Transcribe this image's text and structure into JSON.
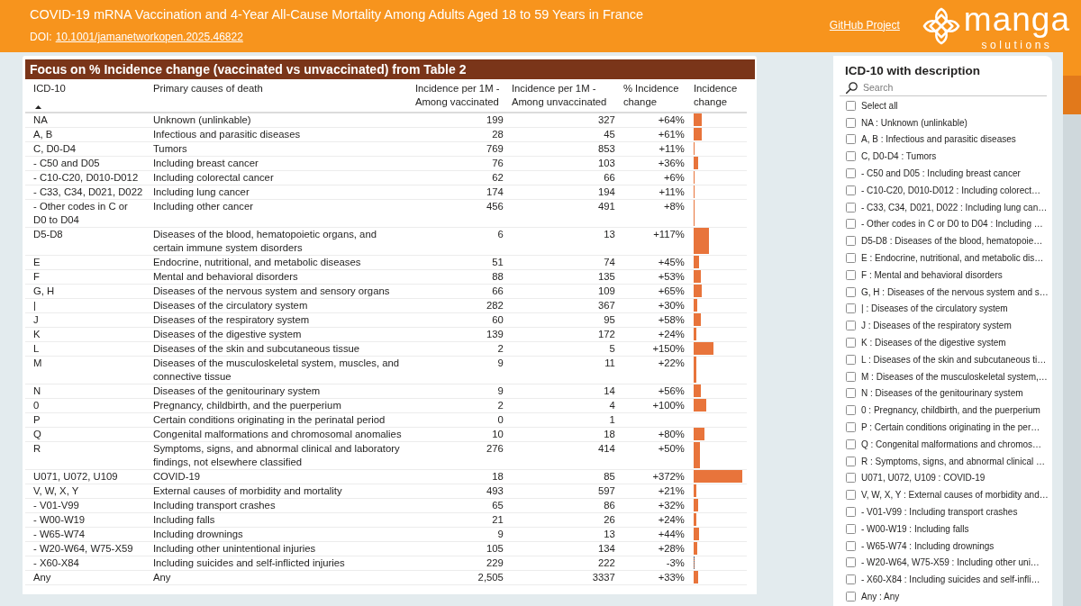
{
  "header": {
    "title": "COVID-19 mRNA Vaccination and 4-Year All-Cause Mortality Among Adults Aged 18 to 59 Years in France",
    "doi_label": "DOI:",
    "doi_link": "10.1001/jamanetworkopen.2025.46822",
    "github_link": "GitHub Project",
    "logo": {
      "name": "manga",
      "tagline": "solutions"
    }
  },
  "table": {
    "title": "Focus on % Incidence change (vaccinated vs unvaccinated) from Table 2",
    "columns": [
      {
        "label": "ICD-10",
        "sorted": true
      },
      {
        "label": "Primary causes of death",
        "sorted": false
      },
      {
        "label": "Incidence per 1M - Among vaccinated",
        "sorted": false
      },
      {
        "label": "Incidence per 1M - Among unvaccinated",
        "sorted": false
      },
      {
        "label": "% Incidence change",
        "sorted": false
      },
      {
        "label": "Incidence change",
        "sorted": false
      }
    ],
    "rows": [
      {
        "icd": "NA",
        "cause": "Unknown (unlinkable)",
        "vaccinated": "199",
        "unvaccinated": "327",
        "change": "+64%"
      },
      {
        "icd": "A, B",
        "cause": "Infectious and parasitic diseases",
        "vaccinated": "28",
        "unvaccinated": "45",
        "change": "+61%"
      },
      {
        "icd": "C, D0-D4",
        "cause": "Tumors",
        "vaccinated": "769",
        "unvaccinated": "853",
        "change": "+11%"
      },
      {
        "icd": "- C50 and D05",
        "cause": "Including breast cancer",
        "vaccinated": "76",
        "unvaccinated": "103",
        "change": "+36%"
      },
      {
        "icd": "- C10-C20, D010-D012",
        "cause": "Including colorectal cancer",
        "vaccinated": "62",
        "unvaccinated": "66",
        "change": "+6%"
      },
      {
        "icd": "- C33, C34, D021, D022",
        "cause": "Including lung cancer",
        "vaccinated": "174",
        "unvaccinated": "194",
        "change": "+11%"
      },
      {
        "icd": "- Other codes in C or D0 to D04",
        "cause": "Including other cancer",
        "vaccinated": "456",
        "unvaccinated": "491",
        "change": "+8%"
      },
      {
        "icd": "D5-D8",
        "cause": "Diseases of the blood, hematopoietic organs, and certain immune system disorders",
        "vaccinated": "6",
        "unvaccinated": "13",
        "change": "+117%"
      },
      {
        "icd": "E",
        "cause": "Endocrine, nutritional, and metabolic diseases",
        "vaccinated": "51",
        "unvaccinated": "74",
        "change": "+45%"
      },
      {
        "icd": "F",
        "cause": "Mental and behavioral disorders",
        "vaccinated": "88",
        "unvaccinated": "135",
        "change": "+53%"
      },
      {
        "icd": "G, H",
        "cause": "Diseases of the nervous system and sensory organs",
        "vaccinated": "66",
        "unvaccinated": "109",
        "change": "+65%"
      },
      {
        "icd": "|",
        "cause": "Diseases of the circulatory system",
        "vaccinated": "282",
        "unvaccinated": "367",
        "change": "+30%"
      },
      {
        "icd": "J",
        "cause": "Diseases of the respiratory system",
        "vaccinated": "60",
        "unvaccinated": "95",
        "change": "+58%"
      },
      {
        "icd": "K",
        "cause": "Diseases of the digestive system",
        "vaccinated": "139",
        "unvaccinated": "172",
        "change": "+24%"
      },
      {
        "icd": "L",
        "cause": "Diseases of the skin and subcutaneous tissue",
        "vaccinated": "2",
        "unvaccinated": "5",
        "change": "+150%"
      },
      {
        "icd": "M",
        "cause": "Diseases of the musculoskeletal system, muscles, and connective tissue",
        "vaccinated": "9",
        "unvaccinated": "11",
        "change": "+22%"
      },
      {
        "icd": "N",
        "cause": "Diseases of the genitourinary system",
        "vaccinated": "9",
        "unvaccinated": "14",
        "change": "+56%"
      },
      {
        "icd": "0",
        "cause": "Pregnancy, childbirth, and the puerperium",
        "vaccinated": "2",
        "unvaccinated": "4",
        "change": "+100%"
      },
      {
        "icd": "P",
        "cause": "Certain conditions originating in the perinatal period",
        "vaccinated": "0",
        "unvaccinated": "1"
      },
      {
        "icd": "Q",
        "cause": "Congenital malformations and chromosomal anomalies",
        "vaccinated": "10",
        "unvaccinated": "18",
        "change": "+80%"
      },
      {
        "icd": "R",
        "cause": "Symptoms, signs, and abnormal clinical and laboratory findings, not elsewhere classified",
        "vaccinated": "276",
        "unvaccinated": "414",
        "change": "+50%"
      },
      {
        "icd": "U071, U072, U109",
        "cause": "COVID-19",
        "vaccinated": "18",
        "unvaccinated": "85",
        "change": "+372%"
      },
      {
        "icd": "V, W, X, Y",
        "cause": "External causes of morbidity and mortality",
        "vaccinated": "493",
        "unvaccinated": "597",
        "change": "+21%"
      },
      {
        "icd": "- V01-V99",
        "cause": "Including transport crashes",
        "vaccinated": "65",
        "unvaccinated": "86",
        "change": "+32%"
      },
      {
        "icd": "- W00-W19",
        "cause": "Including falls",
        "vaccinated": "21",
        "unvaccinated": "26",
        "change": "+24%"
      },
      {
        "icd": "- W65-W74",
        "cause": "Including drownings",
        "vaccinated": "9",
        "unvaccinated": "13",
        "change": "+44%"
      },
      {
        "icd": "- W20-W64, W75-X59",
        "cause": "Including other unintentional injuries",
        "vaccinated": "105",
        "unvaccinated": "134",
        "change": "+28%"
      },
      {
        "icd": "- X60-X84",
        "cause": "Including suicides and self-inflicted injuries",
        "vaccinated": "229",
        "unvaccinated": "222",
        "change": "-3%"
      },
      {
        "icd": "Any",
        "cause": "Any",
        "vaccinated": "2,505",
        "unvaccinated": "3337",
        "change": "+33%"
      }
    ]
  },
  "slicer": {
    "title": "ICD-10 with description",
    "search": {
      "placeholder": "Search"
    },
    "items": [
      {
        "label": "Select all",
        "checked": false
      },
      {
        "label": "NA : Unknown (unlinkable)",
        "checked": false
      },
      {
        "label": "A, B : Infectious and parasitic diseases",
        "checked": false
      },
      {
        "label": "C, D0-D4 : Tumors",
        "checked": false
      },
      {
        "label": "- C50 and D05 : Including breast cancer",
        "checked": false
      },
      {
        "label": "- C10-C20, D010-D012 : Including colorect…",
        "checked": false
      },
      {
        "label": "- C33, C34, D021, D022 : Including lung can…",
        "checked": false
      },
      {
        "label": "- Other codes in C or D0 to D04 : Including …",
        "checked": false
      },
      {
        "label": "D5-D8 : Diseases of the blood, hematopoie…",
        "checked": false
      },
      {
        "label": "E : Endocrine, nutritional, and metabolic dis…",
        "checked": false
      },
      {
        "label": "F : Mental and behavioral disorders",
        "checked": false
      },
      {
        "label": "G, H : Diseases of the nervous system and s…",
        "checked": false
      },
      {
        "label": "| : Diseases of the circulatory system",
        "checked": false
      },
      {
        "label": "J : Diseases of the respiratory system",
        "checked": false
      },
      {
        "label": "K : Diseases of the digestive system",
        "checked": false
      },
      {
        "label": "L : Diseases of the skin and subcutaneous ti…",
        "checked": false
      },
      {
        "label": "M : Diseases of the musculoskeletal system,…",
        "checked": false
      },
      {
        "label": "N : Diseases of the genitourinary system",
        "checked": false
      },
      {
        "label": "0 : Pregnancy, childbirth, and the puerperium",
        "checked": false
      },
      {
        "label": "P : Certain conditions originating in the per…",
        "checked": false
      },
      {
        "label": "Q : Congenital malformations and chromos…",
        "checked": false
      },
      {
        "label": "R : Symptoms, signs, and abnormal clinical …",
        "checked": false
      },
      {
        "label": "U071, U072, U109 : COVID-19",
        "checked": false
      },
      {
        "label": "V, W, X, Y : External causes of morbidity and…",
        "checked": false
      },
      {
        "label": "- V01-V99 : Including transport crashes",
        "checked": false
      },
      {
        "label": "- W00-W19 : Including falls",
        "checked": false
      },
      {
        "label": "- W65-W74 : Including drownings",
        "checked": false
      },
      {
        "label": "- W20-W64, W75-X59 : Including other uni…",
        "checked": false
      },
      {
        "label": "- X60-X84 : Including suicides and self-infli…",
        "checked": false
      },
      {
        "label": "Any : Any",
        "checked": false
      }
    ]
  }
}
